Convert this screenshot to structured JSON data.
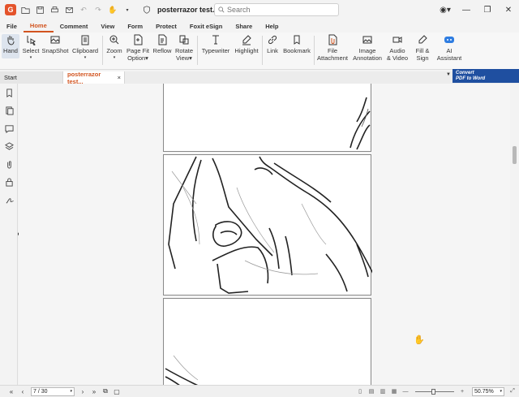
{
  "titlebar": {
    "title": "posterrazor test.pdf - Foxit...",
    "search_placeholder": "Search"
  },
  "menu": [
    "File",
    "Home",
    "Comment",
    "View",
    "Form",
    "Protect",
    "Foxit eSign",
    "Share",
    "Help"
  ],
  "ribbon": {
    "hand": "Hand",
    "select": "Select",
    "snapshot": "SnapShot",
    "clipboard": "Clipboard",
    "zoom": "Zoom",
    "page_fit": "Page Fit",
    "page_fit_2": "Option",
    "reflow": "Reflow",
    "rotate": "Rotate",
    "rotate_2": "View",
    "typewriter": "Typewriter",
    "highlight": "Highlight",
    "link": "Link",
    "bookmark": "Bookmark",
    "file_attach": "File",
    "file_attach_2": "Attachment",
    "image_annot": "Image",
    "image_annot_2": "Annotation",
    "audio_video": "Audio",
    "audio_video_2": "& Video",
    "fill_sign": "Fill &",
    "fill_sign_2": "Sign",
    "ai": "AI",
    "ai_2": "Assistant"
  },
  "tabs": {
    "start": "Start",
    "doc": "posterrazor test...",
    "close": "×"
  },
  "ad": {
    "line1": "Convert",
    "line2": "PDF to Word"
  },
  "status": {
    "page": "7 / 30",
    "zoom": "50.75%"
  },
  "colors": {
    "accent": "#d2541f",
    "ai_blue": "#2f7de1"
  }
}
